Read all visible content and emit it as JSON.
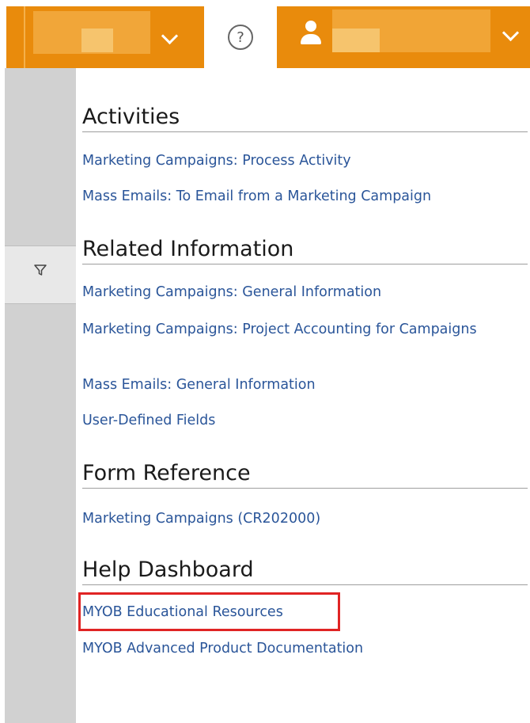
{
  "header": {
    "help_icon": "question-circle-icon",
    "user_icon": "user-icon",
    "chevron_icon": "chevron-down-icon",
    "help_glyph": "?"
  },
  "sidebar": {
    "filter_icon": "filter-icon"
  },
  "sections": [
    {
      "title": "Activities",
      "links": [
        "Marketing Campaigns: Process Activity",
        "Mass Emails: To Email from a Marketing Campaign"
      ]
    },
    {
      "title": "Related Information",
      "links": [
        "Marketing Campaigns: General Information",
        "Marketing Campaigns: Project Accounting for Campaigns",
        "Mass Emails: General Information",
        "User-Defined Fields"
      ]
    },
    {
      "title": "Form Reference",
      "links": [
        "Marketing Campaigns (CR202000)"
      ]
    },
    {
      "title": "Help Dashboard",
      "links": [
        "MYOB Educational Resources",
        "MYOB Advanced Product Documentation"
      ]
    }
  ],
  "colors": {
    "brand_orange": "#e98b0c",
    "link_blue": "#2a5599",
    "highlight_red": "#e02424"
  }
}
